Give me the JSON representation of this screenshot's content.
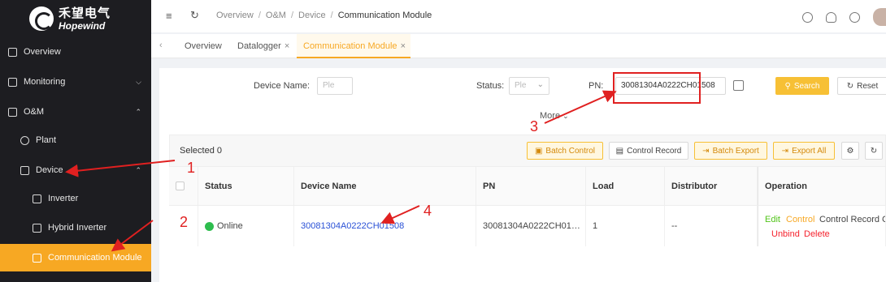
{
  "brand": {
    "name_cn": "禾望电气",
    "name_en": "Hopewind"
  },
  "sidebar": {
    "items": [
      {
        "label": "Overview",
        "icon": "copy-icon"
      },
      {
        "label": "Monitoring",
        "icon": "home-icon",
        "chevron": "⌄"
      },
      {
        "label": "O&M",
        "icon": "building-icon",
        "chevron": "⌃"
      },
      {
        "label": "Plant",
        "icon": "sun-icon"
      },
      {
        "label": "Device",
        "icon": "device-icon",
        "chevron": "⌃"
      },
      {
        "label": "Inverter",
        "icon": "inverter-icon"
      },
      {
        "label": "Hybrid Inverter",
        "icon": "car-icon"
      },
      {
        "label": "Communication Module",
        "icon": "module-icon"
      }
    ]
  },
  "topbar": {
    "breadcrumb": [
      "Overview",
      "O&M",
      "Device",
      "Communication Module"
    ],
    "icons": [
      "menu-fold-icon",
      "refresh-icon",
      "help-icon",
      "cloud-icon",
      "globe-icon",
      "avatar"
    ]
  },
  "tabs": [
    {
      "label": "Overview",
      "closable": false
    },
    {
      "label": "Datalogger",
      "closable": true
    },
    {
      "label": "Communication Module",
      "closable": true,
      "active": true
    }
  ],
  "filters": {
    "device_name_label": "Device Name:",
    "device_name_placeholder": "Ple",
    "status_label": "Status:",
    "status_placeholder": "Ple",
    "pn_label": "PN:",
    "pn_value": "30081304A0222CH01508",
    "search": "Search",
    "reset": "Reset",
    "more": "More"
  },
  "toolbar": {
    "selected": "Selected 0",
    "batch_control": "Batch Control",
    "control_record": "Control Record",
    "batch_export": "Batch Export",
    "export_all": "Export All"
  },
  "table": {
    "columns": [
      "Status",
      "Device Name",
      "PN",
      "Load",
      "Distributor",
      "Operation"
    ],
    "rows": [
      {
        "status": "Online",
        "device_name": "30081304A0222CH01508",
        "pn": "30081304A0222CH01…",
        "load": "1",
        "distributor": "--",
        "ops": [
          "Edit",
          "Control",
          "Control Record",
          "C",
          "Unbind",
          "Delete"
        ]
      }
    ]
  },
  "annotations": [
    "1",
    "2",
    "3",
    "4"
  ],
  "colors": {
    "accent": "#f7a823",
    "sidebar": "#1d1d21",
    "link": "#2950d6",
    "annotation": "#e02020",
    "online": "#2ebd4e"
  }
}
